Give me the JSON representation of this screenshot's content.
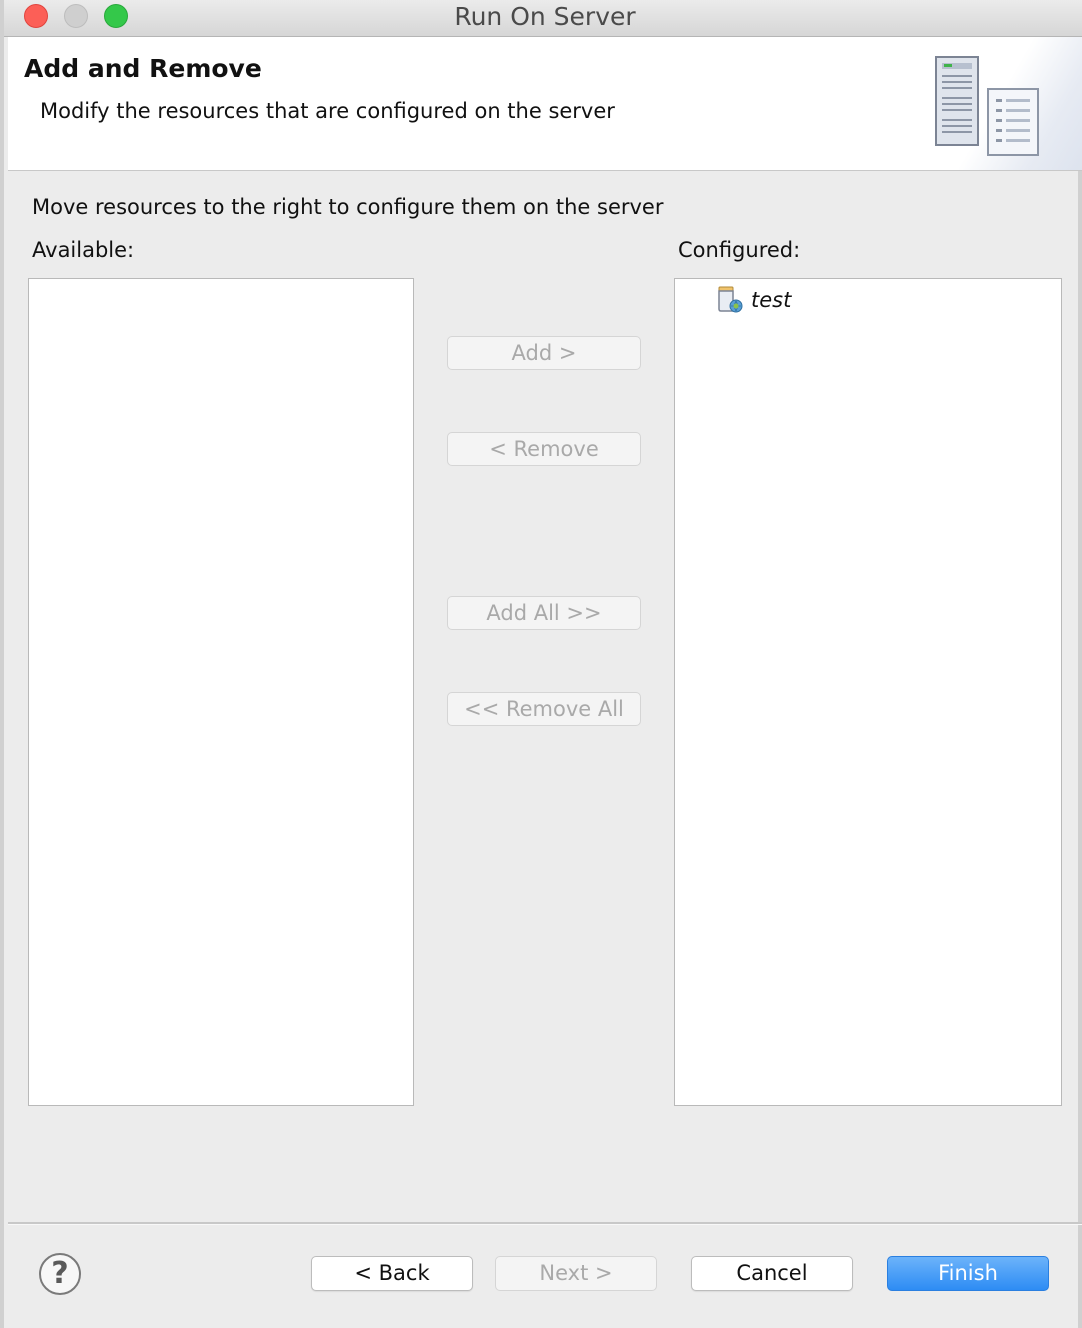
{
  "window": {
    "title": "Run On Server"
  },
  "header": {
    "title": "Add and Remove",
    "description": "Modify the resources that are configured on the server",
    "art_icon": "server-wizard-icon"
  },
  "body": {
    "instruction": "Move resources to the right to configure them on the server",
    "available_label": "Available:",
    "configured_label": "Configured:",
    "available_items": [],
    "configured_items": [
      {
        "label": "test",
        "icon": "web-project-icon"
      }
    ]
  },
  "transfer_buttons": {
    "add": "Add >",
    "remove": "< Remove",
    "add_all": "Add All >>",
    "remove_all": "<< Remove All"
  },
  "footer": {
    "help_icon": "help-icon",
    "back": "< Back",
    "next": "Next >",
    "cancel": "Cancel",
    "finish": "Finish"
  },
  "colors": {
    "primary_button": "#2d8cf4",
    "close_button": "#fc5f57",
    "zoom_button": "#34c84a",
    "disabled_text": "#a9a9a9"
  }
}
